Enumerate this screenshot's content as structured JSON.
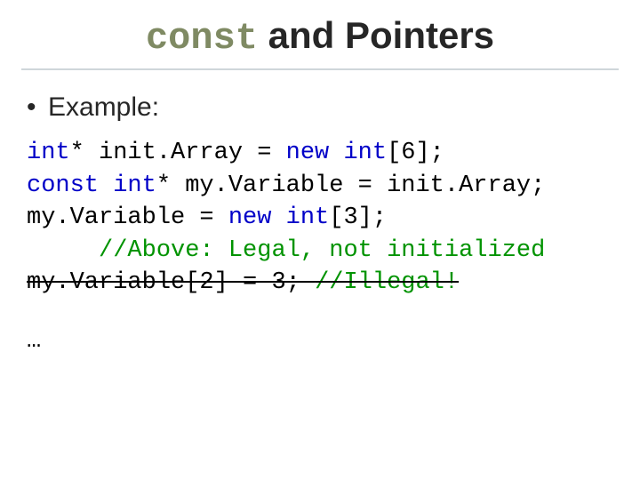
{
  "title": {
    "keyword": "const",
    "rest": " and Pointers"
  },
  "bullets": [
    "Example:"
  ],
  "code": {
    "l1": {
      "kw1": "int",
      "t1": "* init.Array = ",
      "kw2": "new",
      "t2": " ",
      "kw3": "int",
      "t3": "[6];"
    },
    "l2": {
      "kw1": "const",
      "t1": " ",
      "kw2": "int",
      "t2": "* my.Variable = init.Array;"
    },
    "l3": {
      "t1": "my.Variable = ",
      "kw1": "new",
      "t2": " ",
      "kw2": "int",
      "t3": "[3];"
    },
    "l4": {
      "indent": "     ",
      "cm": "//Above: Legal, not initialized"
    },
    "l5": {
      "strike_code": "my.Variable[2] = 3; ",
      "strike_cm": "//Illegal!"
    }
  },
  "ellipsis": "…"
}
